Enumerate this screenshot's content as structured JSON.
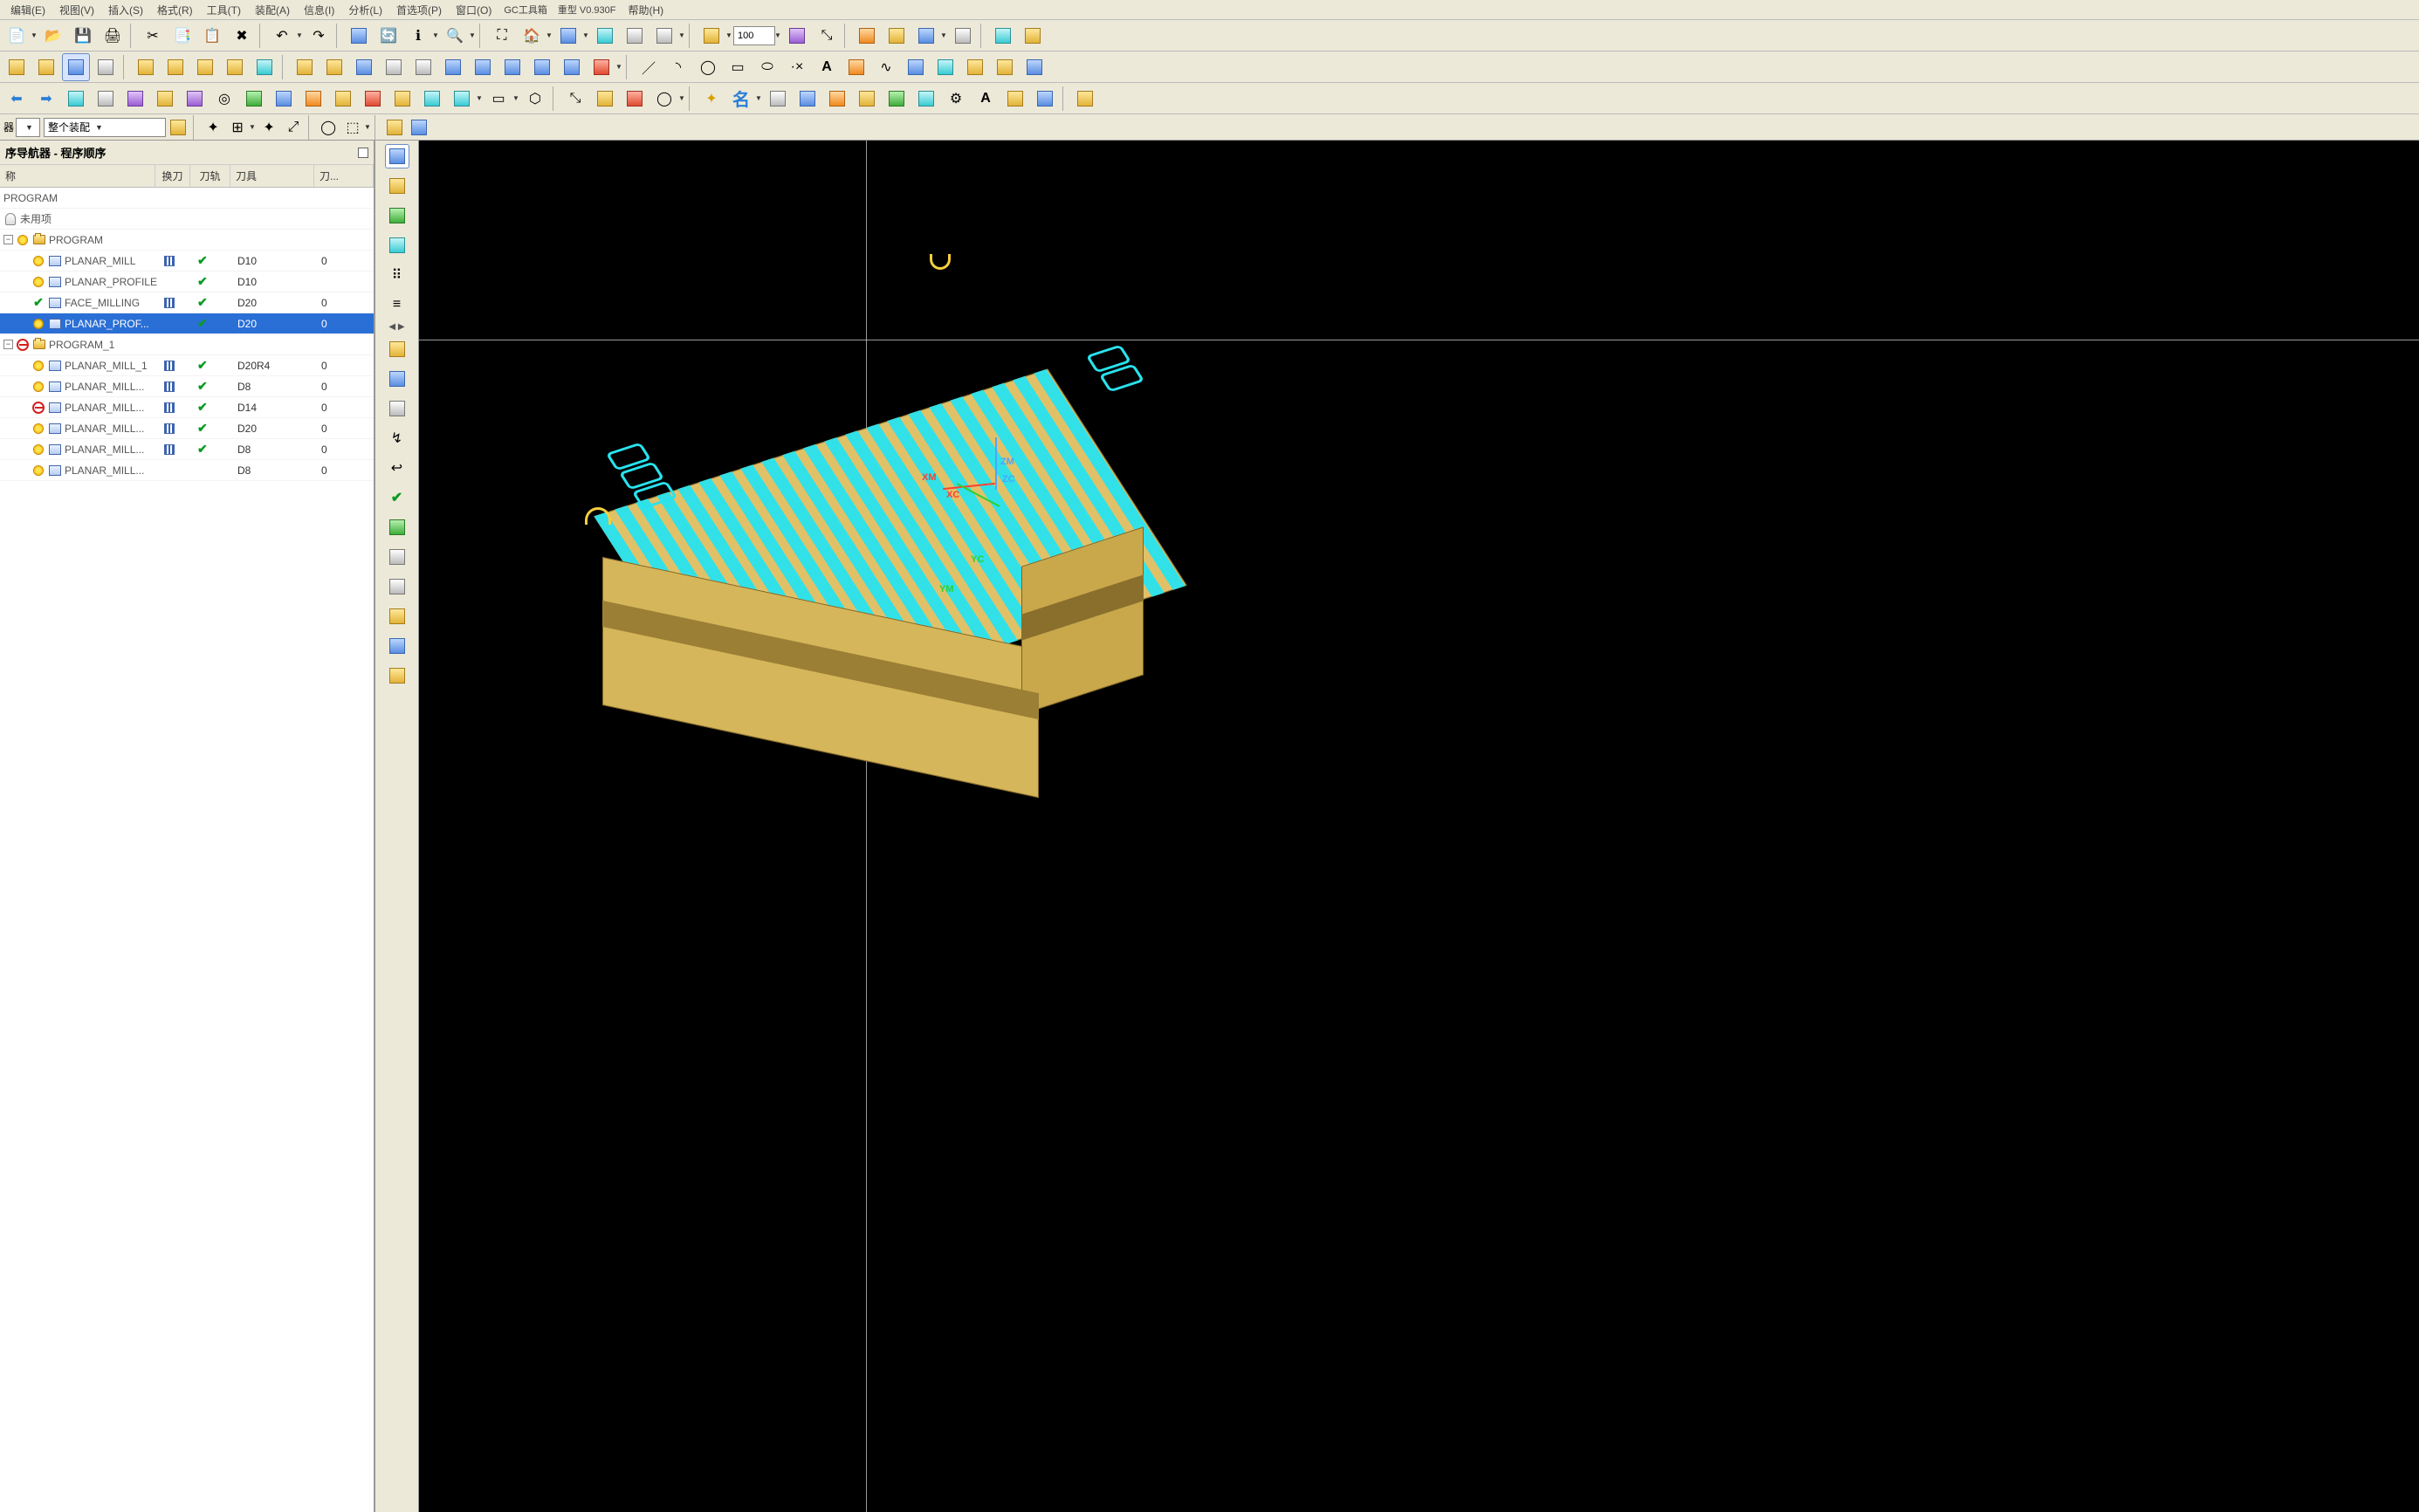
{
  "menu": {
    "items": [
      "编辑(E)",
      "视图(V)",
      "插入(S)",
      "格式(R)",
      "工具(T)",
      "装配(A)",
      "信息(I)",
      "分析(L)",
      "首选项(P)",
      "窗口(O)"
    ],
    "extra1": "GC工具箱",
    "extra2": "重型 V0.930F",
    "help": "帮助(H)"
  },
  "toolbar_number": "100",
  "filter_label": "器",
  "assembly_combo": "整个装配",
  "navigator": {
    "title": "序导航器 - 程序顺序",
    "columns": {
      "name": "称",
      "hdao": "换刀",
      "dg": "刀轨",
      "dj": "刀具",
      "d": "刀..."
    },
    "root": "PROGRAM",
    "unused": "未用项",
    "groups": [
      {
        "label": "PROGRAM",
        "status": "normal",
        "ops": [
          {
            "name": "PLANAR_MILL",
            "hdao": true,
            "dg": true,
            "dj": "D10",
            "d": "0",
            "status": "normal",
            "selected": false
          },
          {
            "name": "PLANAR_PROFILE",
            "hdao": false,
            "dg": true,
            "dj": "D10",
            "d": "",
            "status": "normal",
            "selected": false
          },
          {
            "name": "FACE_MILLING",
            "hdao": true,
            "dg": true,
            "dj": "D20",
            "d": "0",
            "status": "check",
            "selected": false
          },
          {
            "name": "PLANAR_PROF...",
            "hdao": false,
            "dg": true,
            "dj": "D20",
            "d": "0",
            "status": "normal",
            "selected": true
          }
        ]
      },
      {
        "label": "PROGRAM_1",
        "status": "forbid",
        "ops": [
          {
            "name": "PLANAR_MILL_1",
            "hdao": true,
            "dg": true,
            "dj": "D20R4",
            "d": "0",
            "status": "normal",
            "selected": false
          },
          {
            "name": "PLANAR_MILL...",
            "hdao": true,
            "dg": true,
            "dj": "D8",
            "d": "0",
            "status": "normal",
            "selected": false
          },
          {
            "name": "PLANAR_MILL...",
            "hdao": true,
            "dg": true,
            "dj": "D14",
            "d": "0",
            "status": "forbid",
            "selected": false
          },
          {
            "name": "PLANAR_MILL...",
            "hdao": true,
            "dg": true,
            "dj": "D20",
            "d": "0",
            "status": "normal",
            "selected": false
          },
          {
            "name": "PLANAR_MILL...",
            "hdao": true,
            "dg": true,
            "dj": "D8",
            "d": "0",
            "status": "normal",
            "selected": false
          },
          {
            "name": "PLANAR_MILL...",
            "hdao": false,
            "dg": false,
            "dj": "D8",
            "d": "0",
            "status": "normal",
            "selected": false
          }
        ]
      }
    ]
  },
  "viewport": {
    "axes": {
      "xm": "XM",
      "xc": "XC",
      "ym": "YM",
      "yc": "YC",
      "zm": "ZM",
      "zc": "ZC"
    }
  },
  "glyphs": {
    "new": "📄",
    "open": "📂",
    "save": "💾",
    "print": "🖨",
    "cut": "✂",
    "copy": "📑",
    "paste": "📋",
    "delete": "✖",
    "undo": "↶",
    "redo": "↷",
    "refresh": "🔄",
    "info": "ℹ",
    "zoom": "🔍",
    "fit": "⛶",
    "home": "🏠",
    "cube": "◧",
    "wire": "▦",
    "shade": "■",
    "gear": "⚙",
    "arrow_l": "⬅",
    "arrow_r": "➡",
    "line": "／",
    "arc": "◝",
    "circle": "◯",
    "rect": "▭",
    "ellipse": "⬭",
    "pt": "·",
    "text_a": "A",
    "spline": "∿",
    "star": "✦",
    "check": "✔",
    "play": "▶",
    "name": "名",
    "hex": "⬡",
    "xyz": "⤡"
  }
}
